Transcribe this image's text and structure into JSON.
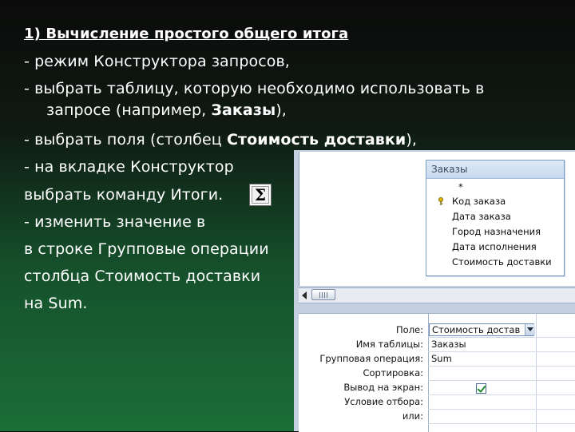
{
  "slide": {
    "heading": "1) Вычисление простого общего итога",
    "line1": "- режим Конструктора запросов,",
    "line2": "- выбрать  таблицу, которую необходимо использовать в",
    "line3_prefix": "запросе (например, ",
    "line3_bold": "Заказы",
    "line3_suffix": "),",
    "line4_prefix": "- выбрать поля (столбец ",
    "line4_bold": "Стоимость доставки",
    "line4_suffix": "),",
    "line5": "- на вкладке Конструктор",
    "line6": " выбрать команду Итоги.",
    "line7": "- изменить значение в",
    "line8": "в строке Групповые операции",
    "line9": "столбца  Стоимость доставки",
    "line10": "на Sum."
  },
  "sigma_button": {
    "glyph": "Σ"
  },
  "designer": {
    "table": {
      "title": "Заказы",
      "fields": [
        "*",
        "Код заказа",
        "Дата заказа",
        "Город назначения",
        "Дата исполнения",
        "Стоимость доставки"
      ],
      "key_icon": "key-icon"
    },
    "grid": {
      "labels": [
        "Поле:",
        "Имя таблицы:",
        "Групповая операция:",
        "Сортировка:",
        "Вывод на экран:",
        "Условие отбора:",
        "или:"
      ],
      "field_value": "Стоимость достав",
      "table_value": "Заказы",
      "group_value": "Sum",
      "show_checked": true
    }
  },
  "colors": {
    "bg_top": "#0b0b0b",
    "bg_bottom": "#1c6e37",
    "designer_bg": "#c4cfdf",
    "table_border": "#7b9cc4"
  }
}
